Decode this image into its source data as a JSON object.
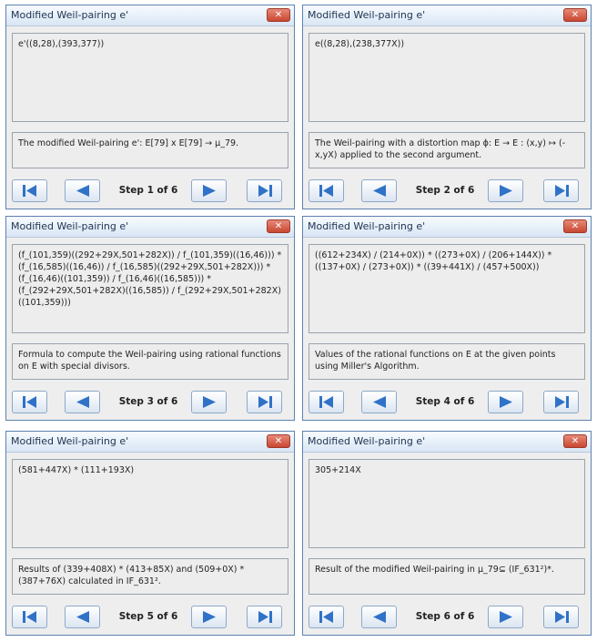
{
  "windows": [
    {
      "title": "Modified Weil-pairing e'",
      "close_label": "✕",
      "expression": "e'((8,28),(393,377))",
      "description": "The modified Weil-pairing e': E[79] x E[79] → μ_79.",
      "step_label": "Step 1 of 6"
    },
    {
      "title": "Modified Weil-pairing e'",
      "close_label": "✕",
      "expression": "e((8,28),(238,377X))",
      "description": "The Weil-pairing with a distortion map ϕ: E → E : (x,y) ↦ (-x,yX) applied to the second argument.",
      "step_label": "Step 2 of 6"
    },
    {
      "title": "Modified Weil-pairing e'",
      "close_label": "✕",
      "expression": "(f_(101,359)((292+29X,501+282X)) / f_(101,359)((16,46))) * (f_(16,585)((16,46)) / f_(16,585)((292+29X,501+282X))) * (f_(16,46)((101,359)) / f_(16,46)((16,585))) * (f_(292+29X,501+282X)((16,585)) / f_(292+29X,501+282X)((101,359)))",
      "description": "Formula to compute the Weil-pairing using rational functions on E with special divisors.",
      "step_label": "Step 3 of 6"
    },
    {
      "title": "Modified Weil-pairing e'",
      "close_label": "✕",
      "expression": "((612+234X) / (214+0X)) * ((273+0X) / (206+144X)) * ((137+0X) / (273+0X)) * ((39+441X) / (457+500X))",
      "description": "Values of the rational functions on E at the given points using Miller's Algorithm.",
      "step_label": "Step 4 of 6"
    },
    {
      "title": "Modified Weil-pairing e'",
      "close_label": "✕",
      "expression": "(581+447X) * (111+193X)",
      "description": "Results of (339+408X) * (413+85X) and (509+0X) * (387+76X) calculated in IF_631².",
      "step_label": "Step 5 of 6"
    },
    {
      "title": "Modified Weil-pairing e'",
      "close_label": "✕",
      "expression": "305+214X",
      "description": "Result of the modified Weil-pairing in μ_79⊆ (IF_631²)*.",
      "step_label": "Step 6 of 6"
    }
  ],
  "icons": {
    "first": "skip-to-first-icon",
    "previous": "previous-arrow-icon",
    "next": "next-arrow-icon",
    "last": "skip-to-last-icon",
    "close": "close-icon"
  },
  "colors": {
    "nav_icon": "#2f72c7",
    "close_button": "#d2553f",
    "window_border": "#5d82b0"
  }
}
